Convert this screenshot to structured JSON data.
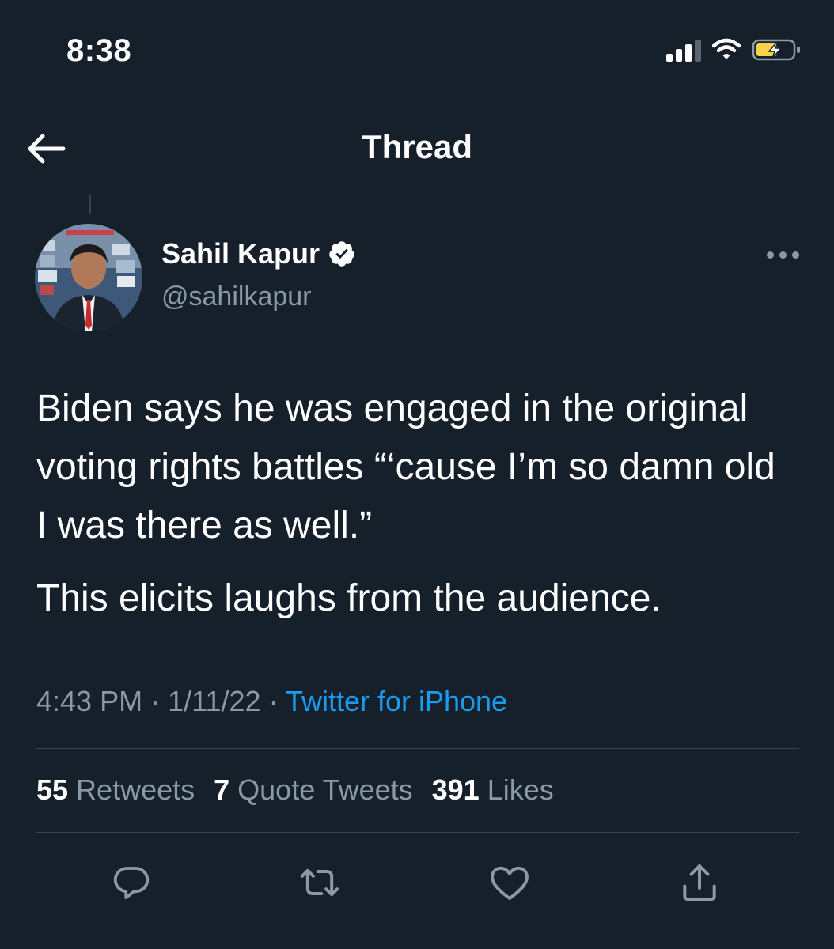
{
  "status_bar": {
    "time": "8:38",
    "icons": [
      "cellular-signal-icon",
      "wifi-icon",
      "battery-charging-icon"
    ]
  },
  "nav": {
    "back_icon": "arrow-left-icon",
    "title": "Thread"
  },
  "tweet": {
    "author": {
      "name": "Sahil Kapur",
      "handle": "@sahilkapur",
      "verified": true
    },
    "paragraphs": [
      "Biden says he was engaged in the original voting rights battles “‘cause I’m so damn old I was there as well.”",
      "This elicits laughs from the audience."
    ],
    "time": "4:43 PM",
    "separator": "·",
    "date": "1/11/22",
    "source": "Twitter for iPhone",
    "stats": {
      "retweets_count": "55",
      "retweets_label": "Retweets",
      "quotes_count": "7",
      "quotes_label": "Quote Tweets",
      "likes_count": "391",
      "likes_label": "Likes"
    }
  },
  "actions": [
    "reply-icon",
    "retweet-icon",
    "like-icon",
    "share-icon"
  ],
  "colors": {
    "background": "#15202b",
    "text": "#ffffff",
    "secondary": "#8b98a5",
    "accent": "#1d9bf0",
    "divider": "#38444d"
  }
}
